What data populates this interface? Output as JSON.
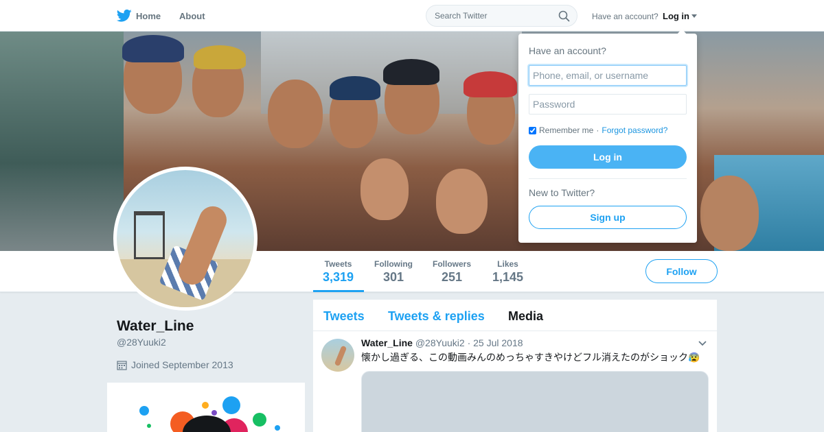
{
  "nav": {
    "home_label": "Home",
    "about_label": "About",
    "icons": {
      "logo": "bird-icon",
      "search": "search-icon",
      "caret": "caret-down-icon"
    }
  },
  "search": {
    "placeholder": "Search Twitter"
  },
  "account": {
    "have_account": "Have an account?",
    "login_label": "Log in"
  },
  "login_dropdown": {
    "title": "Have an account?",
    "username_placeholder": "Phone, email, or username",
    "password_placeholder": "Password",
    "remember_label": "Remember me",
    "separator": "·",
    "forgot_label": "Forgot password?",
    "login_button": "Log in",
    "new_label": "New to Twitter?",
    "signup_button": "Sign up"
  },
  "profile": {
    "name": "Water_Line",
    "handle": "@28Yuuki2",
    "joined": "Joined September 2013"
  },
  "stats": [
    {
      "label": "Tweets",
      "value": "3,319"
    },
    {
      "label": "Following",
      "value": "301"
    },
    {
      "label": "Followers",
      "value": "251"
    },
    {
      "label": "Likes",
      "value": "1,145"
    }
  ],
  "follow_label": "Follow",
  "timeline": {
    "tabs": [
      "Tweets",
      "Tweets & replies",
      "Media"
    ],
    "tweet": {
      "name": "Water_Line",
      "handle": "@28Yuuki2",
      "separator": "·",
      "date": "25 Jul 2018",
      "text": "懐かし過ぎる、この動画みんのめっちゃすきやけどフル消えたのがショック😰"
    }
  },
  "colors": {
    "accent": "#1da1f2",
    "background": "#e6ecf0",
    "secondary_text": "#657786"
  }
}
